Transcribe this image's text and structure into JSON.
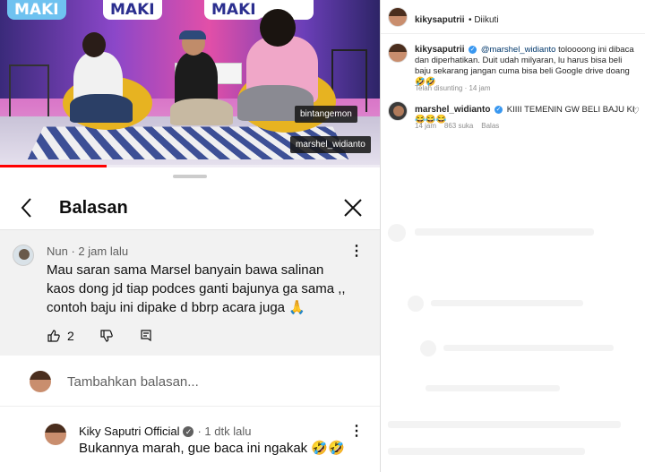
{
  "video": {
    "logos": [
      "MAKI",
      "MAKI",
      "MAKI"
    ],
    "name_tags": [
      "bintangemon",
      "marshel_widianto"
    ],
    "progress_fraction": 0.28
  },
  "panel": {
    "title": "Balasan",
    "comment": {
      "author": "Nun",
      "time": "2 jam lalu",
      "text": "Mau saran sama Marsel banyain bawa salinan kaos dong jd tiap podces ganti bajunya ga sama ,, contoh baju ini dipake d bbrp acara juga 🙏",
      "likes": "2"
    },
    "add_reply_placeholder": "Tambahkan balasan...",
    "reply": {
      "author": "Kiky Saputri Official",
      "time": "1 dtk lalu",
      "text": "Bukannya marah, gue baca ini ngakak 🤣🤣"
    }
  },
  "instagram": {
    "header_user": "kikysaputrii",
    "header_follow": "Diikuti",
    "caption_user": "kikysaputrii",
    "caption_mention": "@marshel_widianto",
    "caption_text": "toloooong ini dibaca dan diperhatikan. Duit udah milyaran, lu harus bisa beli baju sekarang jangan cuma bisa beli Google drive doang 🤣🤣",
    "caption_time": "Telah disunting · 14 jam",
    "comment_user": "marshel_widianto",
    "comment_text": "KIIII TEMENIN GW BELI BAJU KI😂😂😂",
    "comment_time": "14 jam",
    "comment_likes": "863 suka",
    "comment_reply": "Balas"
  },
  "colors": {
    "youtube_red": "#ff0000",
    "ig_link": "#00376b",
    "verified_blue": "#3897f0"
  }
}
